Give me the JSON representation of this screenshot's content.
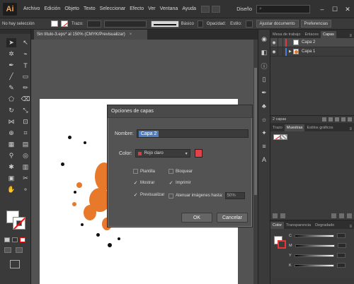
{
  "app": {
    "logo": "Ai"
  },
  "menu": [
    "Archivo",
    "Edición",
    "Objeto",
    "Texto",
    "Seleccionar",
    "Efecto",
    "Ver",
    "Ventana",
    "Ayuda"
  ],
  "window": {
    "workspace": "Diseño",
    "minimize": "–",
    "maximize": "☐",
    "close": "✕"
  },
  "controlbar": {
    "selection_label": "No hay selección",
    "stroke_label": "Trazo:",
    "stroke_style": "Básico",
    "opacity_label": "Opacidad:",
    "style_label": "Estilo:",
    "adjust_button": "Ajustar documento",
    "prefs_button": "Preferencias"
  },
  "document": {
    "tab_title": "Sin título-3.eps* al 150% (CMYK/Previsualizar)",
    "tab_close": "×"
  },
  "dialog": {
    "title": "Opciones de capas",
    "name_label": "Nombre:",
    "name_value": "Capa 2",
    "color_label": "Color:",
    "color_value": "Rojo claro",
    "color_hex": "#e2424a",
    "template_label": "Plantilla",
    "lock_label": "Bloquear",
    "show_label": "Mostrar",
    "print_label": "Imprimir",
    "preview_label": "Previsualizar",
    "dim_label": "Atenuar imágenes hasta:",
    "dim_value": "50%",
    "ok_label": "OK",
    "cancel_label": "Cancelar",
    "checks": {
      "template": false,
      "lock": false,
      "show": true,
      "print": true,
      "preview": true,
      "dim": false
    }
  },
  "layers_panel": {
    "tabs": [
      "Mesa de trabajo",
      "Enlaces",
      "Capas"
    ],
    "active_tab": "Capas",
    "layers": [
      {
        "name": "Capa 2",
        "color": "#e23a3a",
        "selected": true
      },
      {
        "name": "Capa 1",
        "color": "#e8782a",
        "selected": false
      }
    ],
    "footer": "2 capas"
  },
  "swatches_panel": {
    "tabs": [
      "Trazo",
      "Muestras",
      "Estilos gráficos"
    ],
    "active_tab": "Muestras"
  },
  "color_panel": {
    "tabs": [
      "Color",
      "Transparencia",
      "Degradado"
    ],
    "active_tab": "Color",
    "channels": [
      "C",
      "M",
      "Y",
      "K"
    ]
  }
}
